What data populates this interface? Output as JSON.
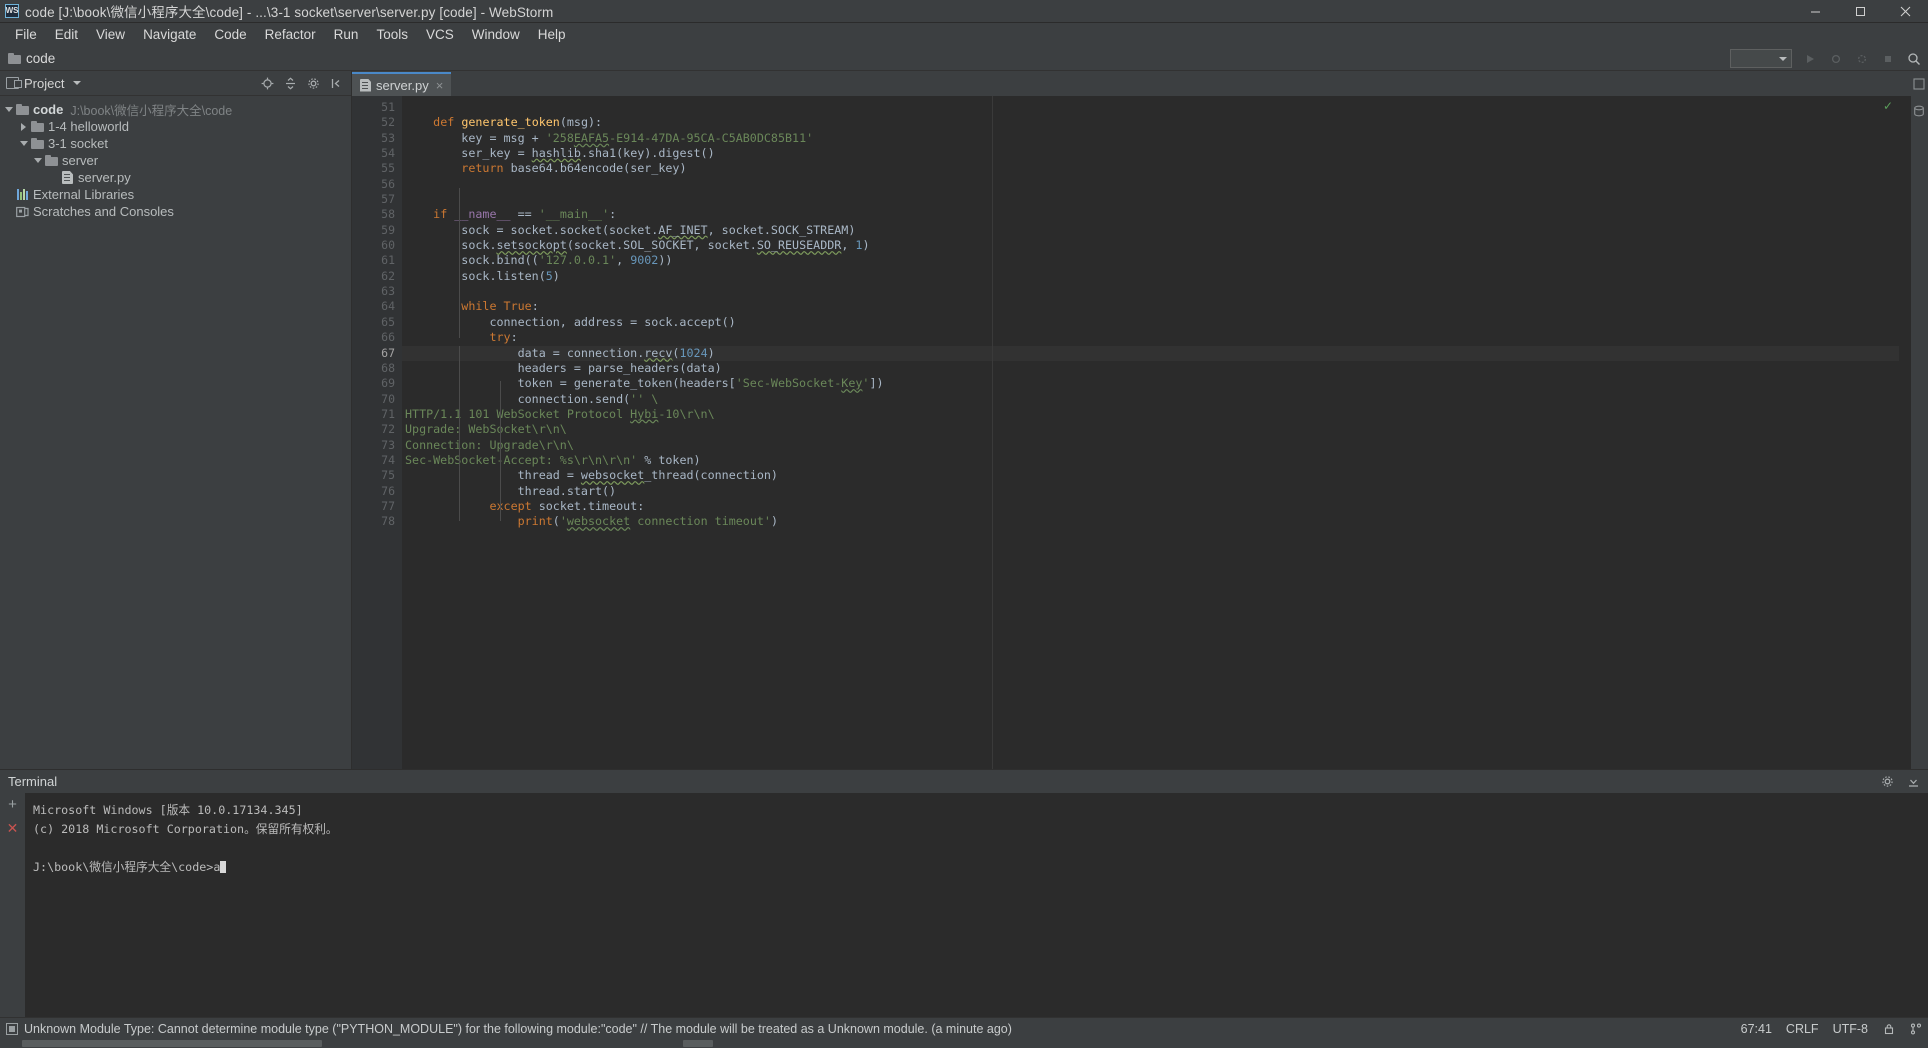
{
  "window": {
    "title": "code [J:\\book\\微信小程序大全\\code] - ...\\3-1 socket\\server\\server.py [code] - WebStorm",
    "logo_text": "WS",
    "controls": {
      "minimize": "minimize-icon",
      "maximize": "maximize-icon",
      "close": "close-icon"
    }
  },
  "menubar": {
    "items": [
      "File",
      "Edit",
      "View",
      "Navigate",
      "Code",
      "Refactor",
      "Run",
      "Tools",
      "VCS",
      "Window",
      "Help"
    ]
  },
  "navbar": {
    "breadcrumb": "code",
    "run_config_placeholder": ""
  },
  "project_panel": {
    "title": "Project",
    "tree": [
      {
        "label": "code",
        "sub": "J:\\book\\微信小程序大全\\code",
        "indent": 0,
        "arrow": "down",
        "icon": "folder-icon",
        "bold": true
      },
      {
        "label": "1-4 helloworld",
        "sub": "",
        "indent": 1,
        "arrow": "right",
        "icon": "folder-icon",
        "bold": false
      },
      {
        "label": "3-1 socket",
        "sub": "",
        "indent": 1,
        "arrow": "down",
        "icon": "folder-icon",
        "bold": false
      },
      {
        "label": "server",
        "sub": "",
        "indent": 2,
        "arrow": "down",
        "icon": "folder-icon",
        "bold": false
      },
      {
        "label": "server.py",
        "sub": "",
        "indent": 3,
        "arrow": "none",
        "icon": "python-file-icon",
        "bold": false
      },
      {
        "label": "External Libraries",
        "sub": "",
        "indent": 0,
        "arrow": "none",
        "icon": "libraries-icon",
        "bold": false
      },
      {
        "label": "Scratches and Consoles",
        "sub": "",
        "indent": 0,
        "arrow": "none",
        "icon": "scratches-icon",
        "bold": false
      }
    ]
  },
  "editor": {
    "tab": {
      "label": "server.py",
      "close": "×",
      "icon": "python-file-icon"
    },
    "first_line_number": 51,
    "active_line": 67,
    "lines": [
      {
        "n": 51,
        "html": ""
      },
      {
        "n": 52,
        "html": "    <span class=\"kw\">def</span> <span class=\"fn\">generate_token</span>(msg):"
      },
      {
        "n": 53,
        "html": "        key = msg + <span class=\"str\">'258<span class=\"err\">EAFA5</span>-E914-47DA-95CA-C5AB0DC85B11'</span>"
      },
      {
        "n": 54,
        "html": "        ser_key = <span class=\"err2\">hashlib</span>.sha1(key).digest()"
      },
      {
        "n": 55,
        "html": "        <span class=\"kw\">return</span> base64.b64encode(ser_key)"
      },
      {
        "n": 56,
        "html": ""
      },
      {
        "n": 57,
        "html": ""
      },
      {
        "n": 58,
        "html": "    <span class=\"kw\">if</span> <span class=\"const\">__name__</span> == <span class=\"str\">'__main__'</span>:"
      },
      {
        "n": 59,
        "html": "        sock = socket.socket(socket.<span class=\"err2\">AF_INET</span>, socket.SOCK_STREAM)"
      },
      {
        "n": 60,
        "html": "        sock.<span class=\"err2\">setsockopt</span>(socket.SOL_SOCKET, socket.<span class=\"err2\">SO_REUSEADDR</span>, <span class=\"num\">1</span>)"
      },
      {
        "n": 61,
        "html": "        sock.bind((<span class=\"str\">'127.0.0.1'</span>, <span class=\"num\">9002</span>))"
      },
      {
        "n": 62,
        "html": "        sock.listen(<span class=\"num\">5</span>)"
      },
      {
        "n": 63,
        "html": ""
      },
      {
        "n": 64,
        "html": "        <span class=\"kw\">while</span> <span class=\"kw\">True</span>:"
      },
      {
        "n": 65,
        "html": "            connection, address = sock.accept()"
      },
      {
        "n": 66,
        "html": "            <span class=\"kw\">try</span>:"
      },
      {
        "n": 67,
        "html": "                data = connection.<span class=\"err2\">recv</span>(<span class=\"num\">1024</span>)"
      },
      {
        "n": 68,
        "html": "                headers = parse_headers(data)"
      },
      {
        "n": 69,
        "html": "                token = generate_token(headers[<span class=\"str\">'Sec-WebSocket-<span class=\"err\">Key</span>'</span>])"
      },
      {
        "n": 70,
        "html": "                connection.send(<span class=\"str\">'' \\</span>"
      },
      {
        "n": 71,
        "html": "<span class=\"str\">HTTP/1.1 101 WebSocket Protocol <span class=\"err\">Hybi</span>-10\\r\\n\\</span>"
      },
      {
        "n": 72,
        "html": "<span class=\"str\">Upgrade: WebSocket\\r\\n\\</span>"
      },
      {
        "n": 73,
        "html": "<span class=\"str\">Connection: Upgrade\\r\\n\\</span>"
      },
      {
        "n": 74,
        "html": "<span class=\"str\">Sec-WebSocket-Accept: %s\\r\\n\\r\\n'</span> % token)"
      },
      {
        "n": 75,
        "html": "                thread = <span class=\"err2\">websocket</span>_thread(connection)"
      },
      {
        "n": 76,
        "html": "                thread.start()"
      },
      {
        "n": 77,
        "html": "            <span class=\"kw\">except</span> socket.timeout:"
      },
      {
        "n": 78,
        "html": "                <span class=\"kw\">print</span>(<span class=\"str\">'<span class=\"err\">websocket</span> connection timeout'</span>)"
      }
    ],
    "inspection_status": "✓"
  },
  "terminal": {
    "title": "Terminal",
    "lines": [
      "Microsoft Windows [版本 10.0.17134.345]",
      "(c) 2018 Microsoft Corporation。保留所有权利。",
      "",
      "J:\\book\\微信小程序大全\\code>a"
    ],
    "new_tab": "+",
    "close_tab": "✕"
  },
  "statusbar": {
    "message": "Unknown Module Type: Cannot determine module type (\"PYTHON_MODULE\") for the following module:\"code\" // The module will be treated as a Unknown module. (a minute ago)",
    "caret_position": "67:41",
    "line_separator": "CRLF",
    "encoding": "UTF-8",
    "lock_icon": "lock-icon",
    "branch_icon": "branch-icon"
  }
}
